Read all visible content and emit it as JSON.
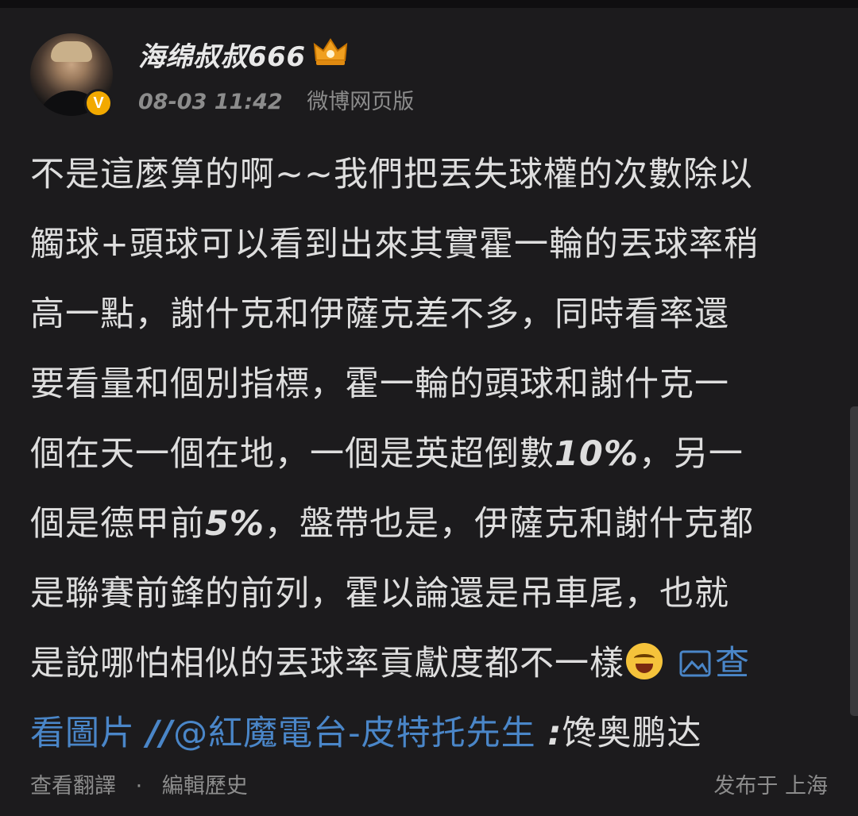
{
  "header": {
    "username": "海绵叔叔666",
    "time": "08-03 11:42",
    "source": "微博网页版",
    "verified_badge": "V",
    "icons": {
      "avatar": "user-avatar",
      "crown": "crown-icon",
      "badge": "verified-badge-icon"
    },
    "colors": {
      "badge": "#f2a900",
      "crown": "#f0a020"
    }
  },
  "post": {
    "lines": [
      [
        {
          "t": "不是這麼算的啊~~我們把丟失球權的次數除以"
        }
      ],
      [
        {
          "t": "觸球+頭球可以看到出來其實霍一輪的丟球率稍"
        }
      ],
      [
        {
          "t": "高一點，謝什克和伊薩克差不多，同時看率還"
        }
      ],
      [
        {
          "t": "要看量和個別指標，霍一輪的頭球和謝什克一"
        }
      ],
      [
        {
          "t": "個在天一個在地，一個是英超倒數"
        },
        {
          "t": "10%",
          "em": true
        },
        {
          "t": "，另一"
        }
      ],
      [
        {
          "t": "個是德甲前"
        },
        {
          "t": "5%",
          "em": true
        },
        {
          "t": "，盤帶也是，伊薩克和謝什克都"
        }
      ],
      [
        {
          "t": "是聯賽前鋒的前列，霍以論還是吊車尾，也就"
        }
      ],
      [
        {
          "t": "是說哪怕相似的丟球率貢獻度都不一樣"
        },
        {
          "emoji": "laughing-crying-emoji"
        },
        {
          "icon": "image-icon"
        },
        {
          "t": "查",
          "link": true
        }
      ],
      [
        {
          "t": "看圖片 ",
          "link": true
        },
        {
          "t": "//",
          "link": true,
          "em": true
        },
        {
          "t": "@紅魔電台-皮特托先生",
          "link": true
        },
        {
          "t": " ",
          "link": false
        },
        {
          "t": ":",
          "em": true
        },
        {
          "t": "馋奥鹏达"
        }
      ]
    ],
    "colors": {
      "text": "#dedede",
      "link": "#4a86c8"
    }
  },
  "footer": {
    "translate": "查看翻譯",
    "separator": "·",
    "edit_history": "編輯歷史",
    "location": "发布于 上海"
  }
}
